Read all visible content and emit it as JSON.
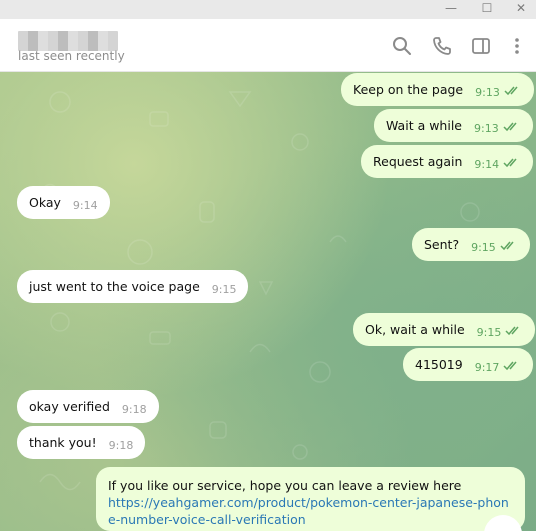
{
  "window": {
    "minimize": "—",
    "maximize": "☐",
    "close": "✕"
  },
  "header": {
    "status": "last seen recently"
  },
  "icons": {
    "search": "search-icon",
    "call": "phone-icon",
    "sidebar": "sidebar-toggle-icon",
    "more": "more-vertical-icon",
    "ticks": "double-check-icon"
  },
  "colors": {
    "outgoing_bubble": "#eefed9",
    "incoming_bubble": "#ffffff",
    "tick_green": "#5fa561",
    "link": "#2a78b5"
  },
  "messages": [
    {
      "dir": "out",
      "text": "Keep on the page",
      "time": "9:13"
    },
    {
      "dir": "out",
      "text": "Wait a while",
      "time": "9:13"
    },
    {
      "dir": "out",
      "text": "Request again",
      "time": "9:14"
    },
    {
      "dir": "in",
      "text": "Okay",
      "time": "9:14"
    },
    {
      "dir": "out",
      "text": "Sent?",
      "time": "9:15"
    },
    {
      "dir": "in",
      "text": "just went to the voice page",
      "time": "9:15"
    },
    {
      "dir": "out",
      "text": "Ok, wait a while",
      "time": "9:15"
    },
    {
      "dir": "out",
      "text": "415019",
      "time": "9:17"
    },
    {
      "dir": "in",
      "text": "okay verified",
      "time": "9:18"
    },
    {
      "dir": "in",
      "text": "thank you!",
      "time": "9:18"
    },
    {
      "dir": "out",
      "text": "If you like our service, hope you can leave a review here",
      "link": "https://yeahgamer.com/product/pokemon-center-japanese-phone-number-voice-call-verification"
    }
  ]
}
